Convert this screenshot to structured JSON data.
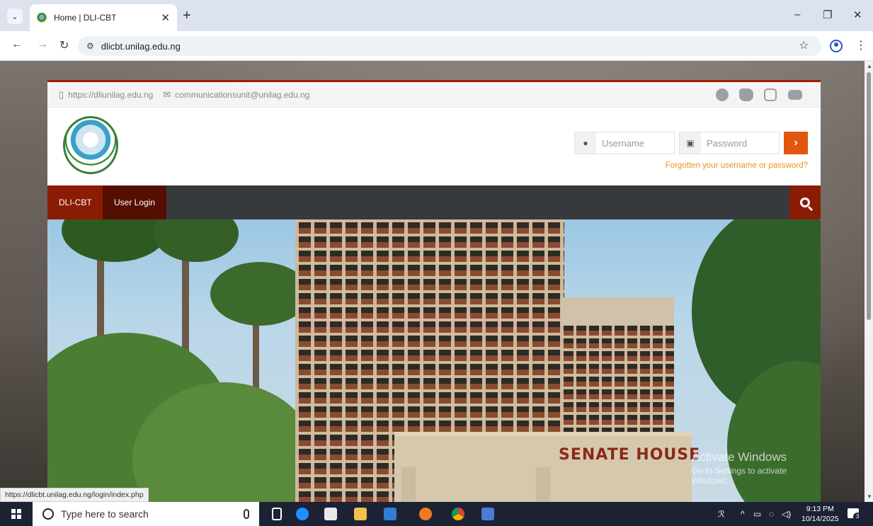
{
  "browser": {
    "tab_title": "Home | DLI-CBT",
    "address": "dlicbt.unilag.edu.ng",
    "status_url": "https://dlicbt.unilag.edu.ng/login/index.php"
  },
  "site": {
    "topbar": {
      "website": "https://dliunilag.edu.ng",
      "email": "communicationsunit@unilag.edu.ng",
      "social_icons": [
        "facebook-icon",
        "twitter-icon",
        "instagram-icon",
        "youtube-icon"
      ]
    },
    "login": {
      "username_placeholder": "Username",
      "password_placeholder": "Password",
      "submit_glyph": "›",
      "forgot_link": "Forgotten your username or password?"
    },
    "nav": {
      "items": [
        {
          "label": "DLI-CBT"
        },
        {
          "label": "User Login"
        }
      ]
    },
    "hero": {
      "sign_text": "SENATE HOUSE"
    }
  },
  "os": {
    "watermark_title": "Activate Windows",
    "watermark_sub": "Go to Settings to activate Windows.",
    "search_placeholder": "Type here to search",
    "time": "9:13 PM",
    "date": "10/14/2025",
    "notification_count": "3"
  },
  "colors": {
    "accent": "#a01b06",
    "nav_bg": "#373a3c",
    "login_button": "#e2560d",
    "forgot_link": "#e89418"
  }
}
